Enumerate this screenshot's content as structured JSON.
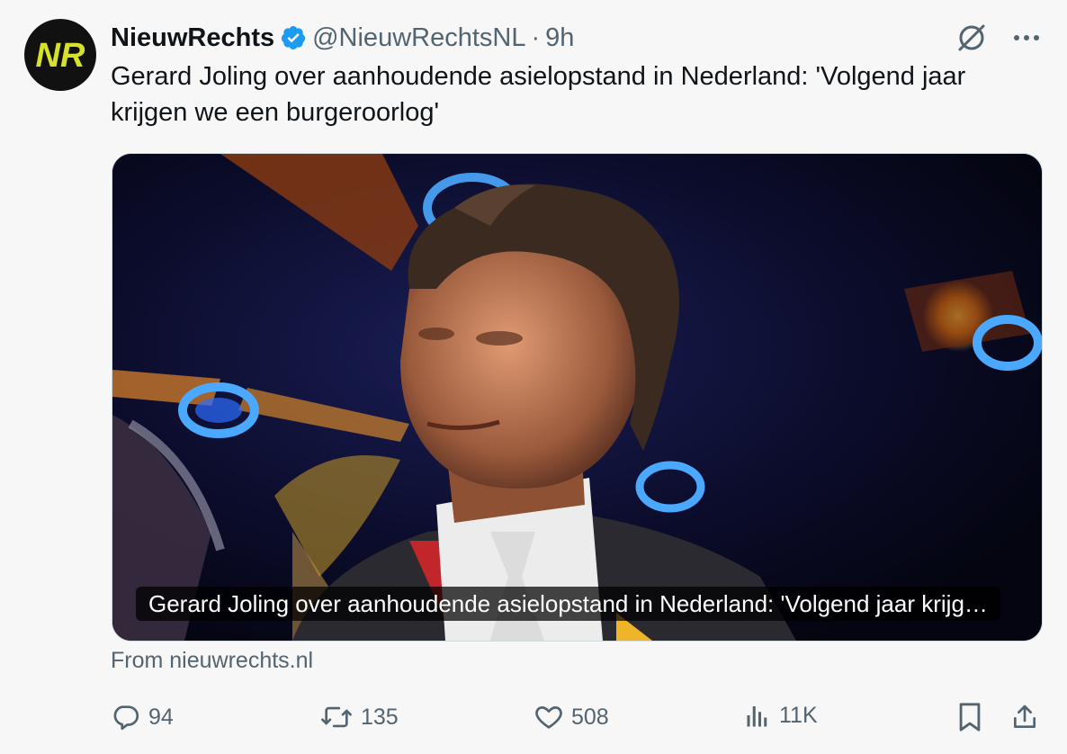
{
  "tweet": {
    "display_name": "NieuwRechts",
    "handle": "@NieuwRechtsNL",
    "separator": "·",
    "time": "9h",
    "avatar_text": "NR",
    "text": "Gerard Joling over aanhoudende asielopstand in Nederland: 'Volgend jaar krijgen we een burgeroorlog'"
  },
  "card": {
    "caption": "Gerard Joling over aanhoudende asielopstand in Nederland: 'Volgend jaar krijg…",
    "source": "From nieuwrechts.nl"
  },
  "actions": {
    "replies": "94",
    "reposts": "135",
    "likes": "508",
    "views": "11K"
  },
  "icons": {
    "verified": "verified-badge-icon",
    "grok": "grok-icon",
    "more": "more-icon",
    "reply": "reply-icon",
    "repost": "repost-icon",
    "like": "heart-icon",
    "views": "views-icon",
    "bookmark": "bookmark-icon",
    "share": "share-icon"
  },
  "colors": {
    "verified": "#1d9bf0",
    "text": "#0f1419",
    "muted": "#536471",
    "avatar_logo": "#d6e22a"
  }
}
